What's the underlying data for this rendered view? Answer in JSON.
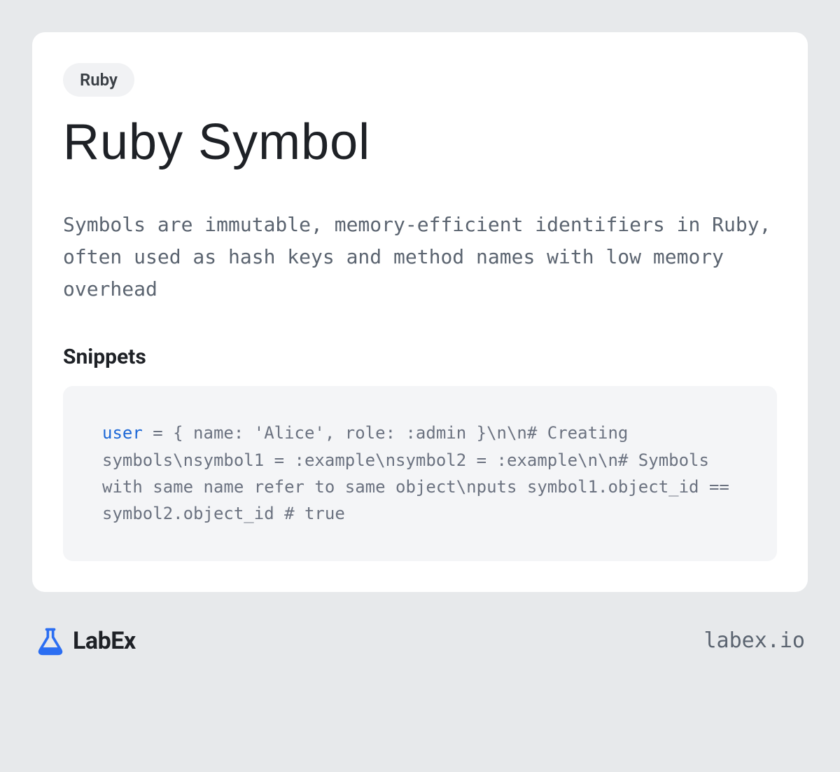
{
  "tag": "Ruby",
  "title": "Ruby Symbol",
  "description": "Symbols are immutable, memory-efficient identifiers in Ruby, often used as hash keys and method names with low memory overhead",
  "snippets_heading": "Snippets",
  "code": {
    "keyword": "user",
    "rest": " = { name: 'Alice', role: :admin }\\n\\n# Creating symbols\\nsymbol1 = :example\\nsymbol2 = :example\\n\\n# Symbols with same name refer to same object\\nputs symbol1.object_id == symbol2.object_id  # true"
  },
  "brand": {
    "name": "LabEx",
    "url": "labex.io"
  }
}
